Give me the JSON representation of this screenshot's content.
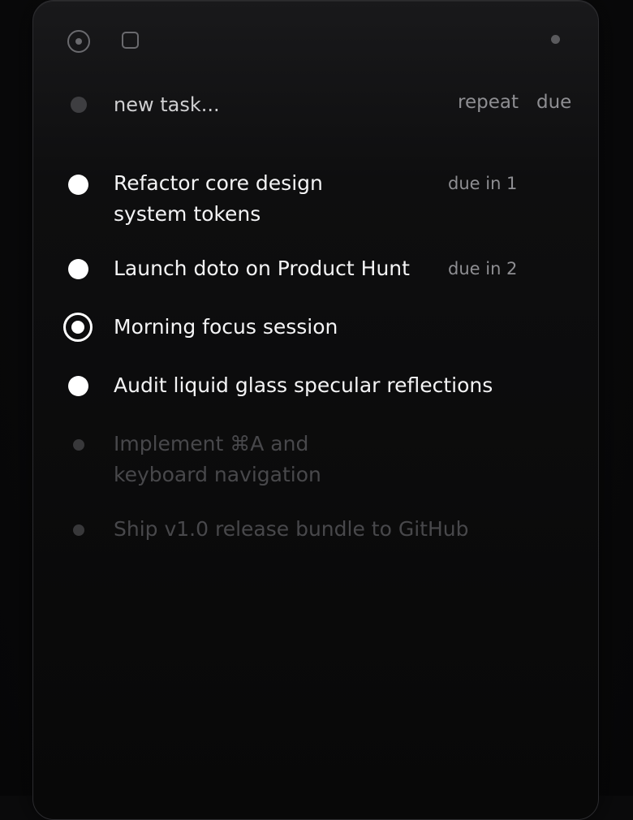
{
  "toolbar": {
    "left_icons": [
      "target-icon",
      "square-icon"
    ],
    "right_icon": "dot-icon"
  },
  "new_task": {
    "placeholder": "new task...",
    "repeat_label": "repeat",
    "due_label": "due"
  },
  "tasks": [
    {
      "line1": "Refactor core design",
      "line2": "system tokens",
      "due": "due in 1",
      "state": "open"
    },
    {
      "line1": "Launch doto on Product Hunt",
      "due": "due in 2",
      "state": "open"
    },
    {
      "line1": "Morning focus session",
      "state": "focused"
    },
    {
      "line1": "Audit liquid glass specular reflections",
      "state": "open"
    },
    {
      "line1": "Implement ⌘A and",
      "line2": "keyboard navigation",
      "state": "done"
    },
    {
      "line1": "Ship v1.0 release bundle to GitHub",
      "state": "done"
    }
  ],
  "colors": {
    "text_primary": "#f4f4f5",
    "text_secondary": "#8e8e92",
    "text_done": "#48484b",
    "panel_bg": "#080808"
  }
}
